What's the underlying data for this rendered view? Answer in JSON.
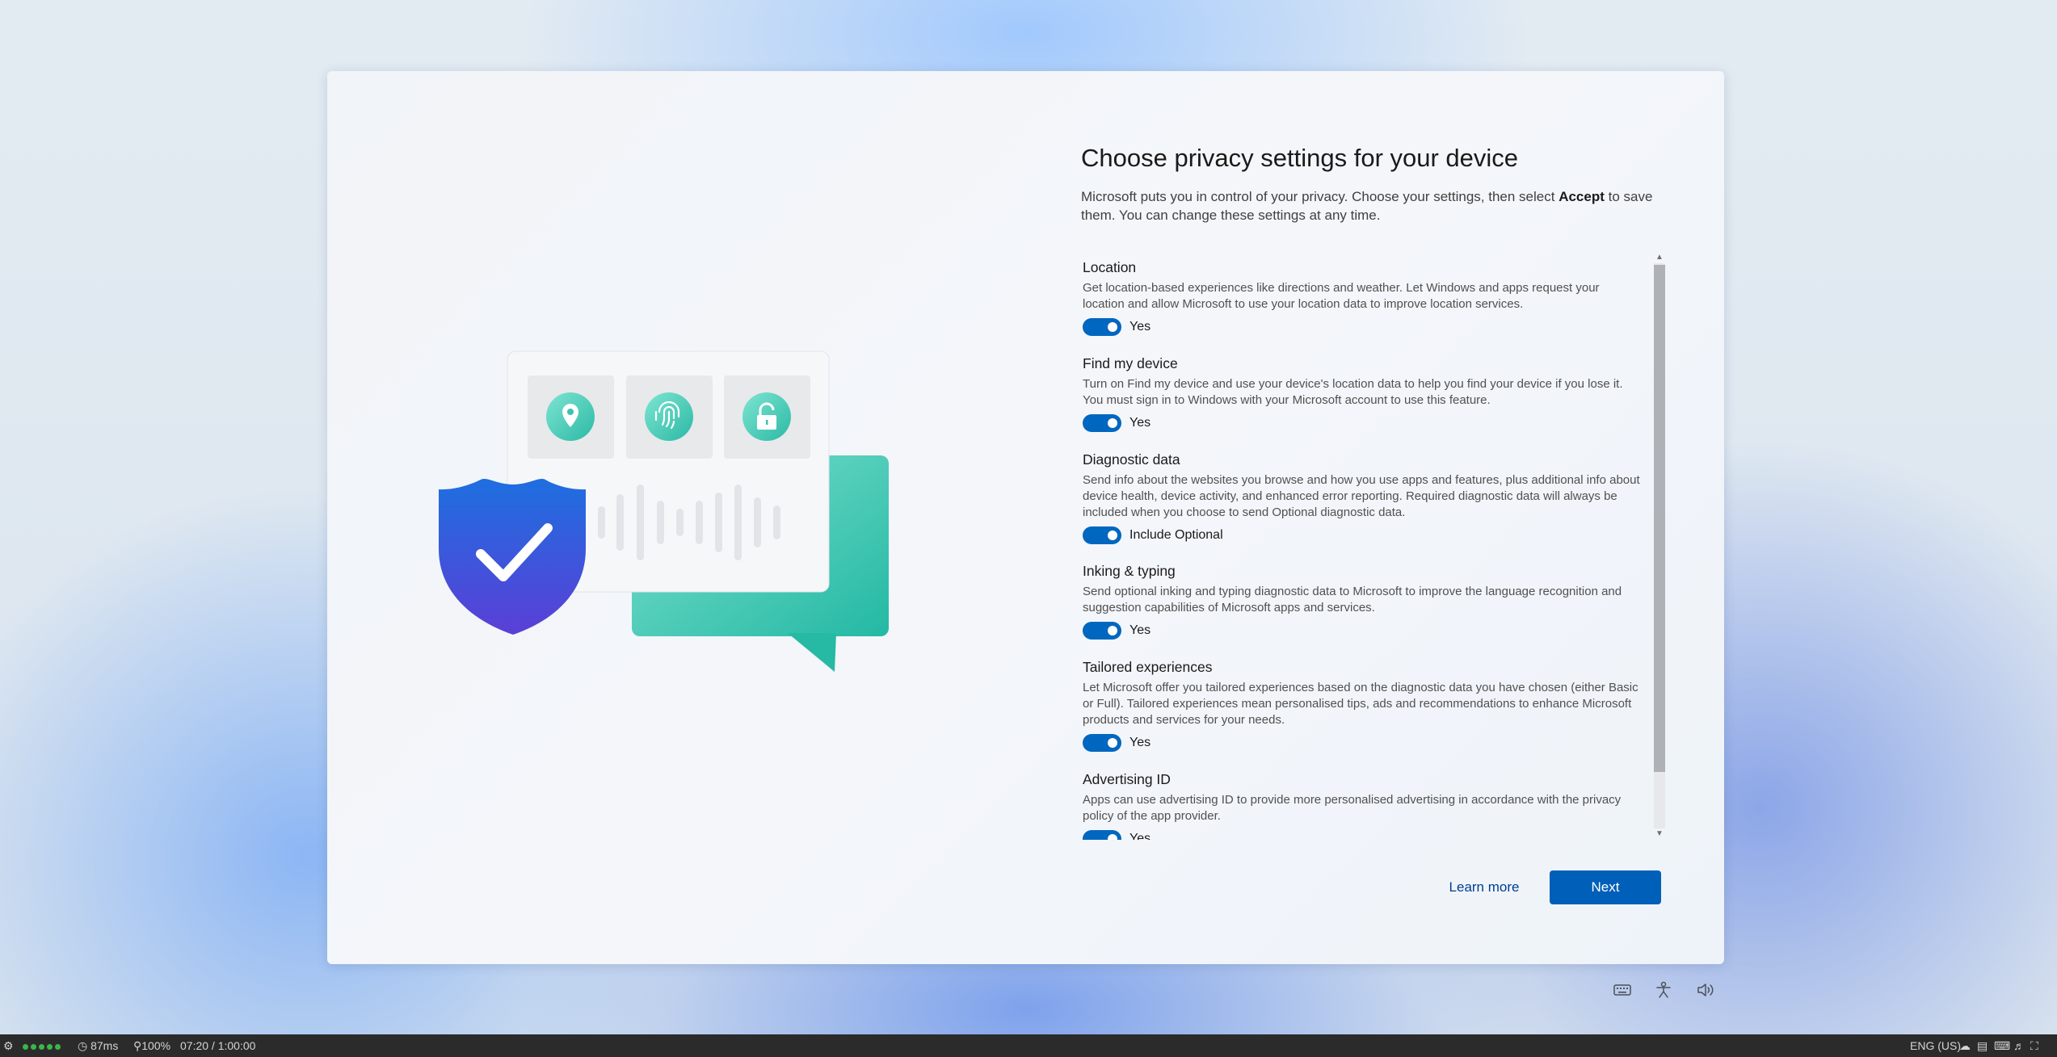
{
  "page": {
    "title": "Choose privacy settings for your device",
    "subtitle_pre": "Microsoft puts you in control of your privacy. Choose your settings, then select ",
    "subtitle_bold": "Accept",
    "subtitle_post": " to save them. You can change these settings at any time."
  },
  "settings": [
    {
      "title": "Location",
      "description": "Get location-based experiences like directions and weather. Let Windows and apps request your location and allow Microsoft to use your location data to improve location services.",
      "value": "Yes"
    },
    {
      "title": "Find my device",
      "description": "Turn on Find my device and use your device's location data to help you find your device if you lose it. You must sign in to Windows with your Microsoft account to use this feature.",
      "value": "Yes"
    },
    {
      "title": "Diagnostic data",
      "description": "Send info about the websites you browse and how you use apps and features, plus additional info about device health, device activity, and enhanced error reporting. Required diagnostic data will always be included when you choose to send Optional diagnostic data.",
      "value": "Include Optional"
    },
    {
      "title": "Inking & typing",
      "description": "Send optional inking and typing diagnostic data to Microsoft to improve the language recognition and suggestion capabilities of Microsoft apps and services.",
      "value": "Yes"
    },
    {
      "title": "Tailored experiences",
      "description": "Let Microsoft offer you tailored experiences based on the diagnostic data you have chosen (either Basic or Full). Tailored experiences mean personalised tips, ads and recommendations to enhance Microsoft products and services for your needs.",
      "value": "Yes"
    },
    {
      "title": "Advertising ID",
      "description": "Apps can use advertising ID to provide more personalised advertising in accordance with the privacy policy of the app provider.",
      "value": "Yes"
    }
  ],
  "buttons": {
    "learn_more": "Learn more",
    "next": "Next"
  },
  "ease_icons": [
    "keyboard-icon",
    "accessibility-icon",
    "speaker-icon"
  ],
  "taskbar": {
    "latency": "87ms",
    "zoom": "100%",
    "time": "07:20 / 1:00:00",
    "language": "ENG (US)"
  },
  "colors": {
    "accent": "#005fb8",
    "toggle_on": "#0067c0",
    "link": "#003e92"
  }
}
